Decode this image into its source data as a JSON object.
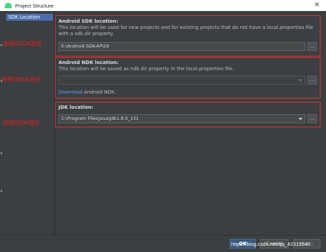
{
  "window": {
    "title": "Project Structure"
  },
  "sidebar": {
    "items": [
      {
        "label": "SDK Location"
      }
    ]
  },
  "sdk": {
    "title": "Android SDK location:",
    "description": "This location will be used for new projects and for existing projects that do not have a local.properties file with a sdk.dir property.",
    "path": "E:\\Android-SDK-API29",
    "browse_label": "..."
  },
  "ndk": {
    "title": "Android NDK location:",
    "description": "This location will be saved as ndk.dir property in the local.properties file.",
    "path": "",
    "browse_label": "...",
    "download_link": "Download",
    "download_suffix": " Android NDK."
  },
  "jdk": {
    "title": "JDK location:",
    "path": "C:\\Program Files\\Java\\jdk1.8.0_131",
    "browse_label": "..."
  },
  "annotations": {
    "sdk": "使用的SDK路径",
    "ndk": "使用的NDK路径",
    "jdk": "使用的JDK路径"
  },
  "buttons": {
    "ok": "OK",
    "cancel": "Cancel",
    "apply": "Apply"
  },
  "watermark": "https://blog.csdn.net/qq_42315540",
  "colors": {
    "background": "#3c3f41",
    "selection": "#4b6eaf",
    "annotation_red": "#e03030",
    "link": "#589df6"
  }
}
